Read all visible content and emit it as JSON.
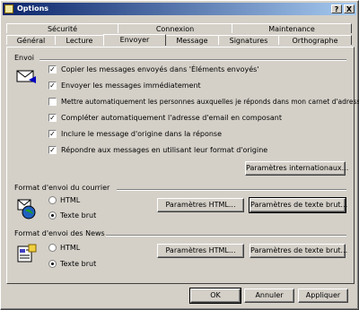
{
  "window": {
    "title": "Options",
    "help_label": "?",
    "close_label": "X"
  },
  "tabs_top": [
    "Sécurité",
    "Connexion",
    "Maintenance"
  ],
  "tabs_bottom": [
    "Général",
    "Lecture",
    "Envoyer",
    "Message",
    "Signatures",
    "Orthographe"
  ],
  "active_tab": "Envoyer",
  "envoi": {
    "title": "Envoi",
    "options": [
      {
        "label": "Copier les messages envoyés dans 'Éléments envoyés'",
        "checked": true
      },
      {
        "label": "Envoyer les messages immédiatement",
        "checked": true
      },
      {
        "label": "Mettre automatiquement les personnes auxquelles je réponds dans mon carnet d'adresses",
        "checked": false
      },
      {
        "label": "Compléter automatiquement l'adresse d'email en composant",
        "checked": true
      },
      {
        "label": "Inclure le message d'origine dans la réponse",
        "checked": true
      },
      {
        "label": "Répondre aux messages en utilisant leur format d'origine",
        "checked": true
      }
    ],
    "intl_button": "Paramètres internationaux..."
  },
  "mail_format": {
    "title": "Format d'envoi du courrier",
    "html_label": "HTML",
    "text_label": "Texte brut",
    "selected": "Texte brut",
    "html_settings": "Paramètres HTML...",
    "text_settings": "Paramètres de texte brut..."
  },
  "news_format": {
    "title": "Format d'envoi des News",
    "html_label": "HTML",
    "text_label": "Texte brut",
    "selected": "Texte brut",
    "html_settings": "Paramètres HTML...",
    "text_settings": "Paramètres de texte brut..."
  },
  "footer": {
    "ok": "OK",
    "cancel": "Annuler",
    "apply": "Appliquer"
  }
}
